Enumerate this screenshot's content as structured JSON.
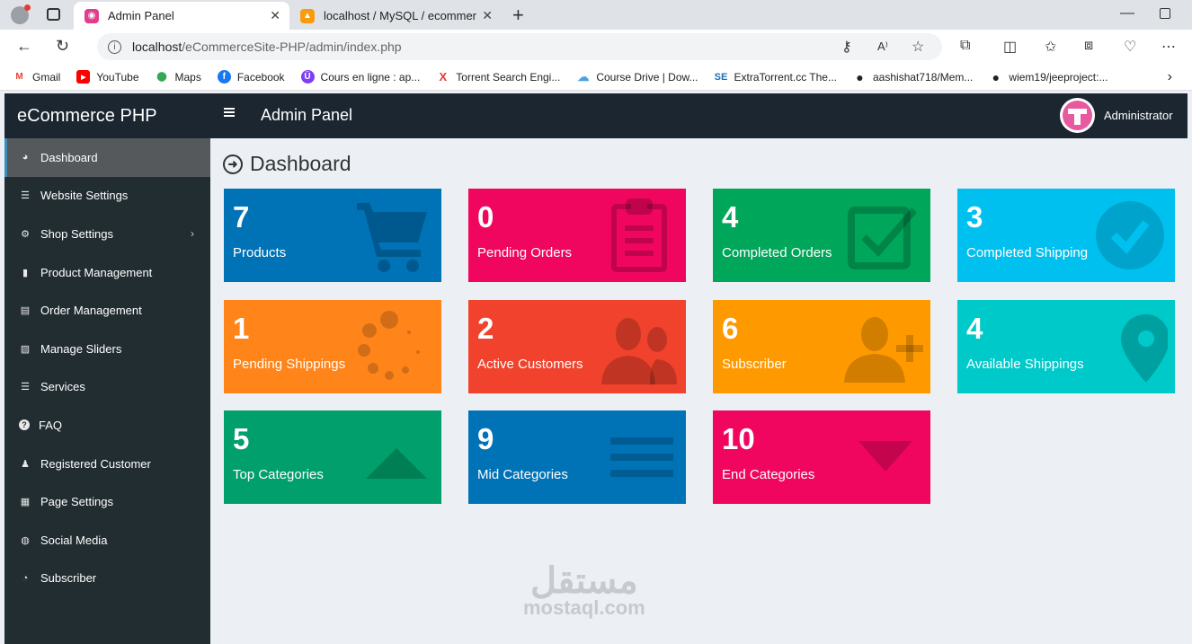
{
  "browser": {
    "tabs": [
      {
        "title": "Admin Panel",
        "active": true
      },
      {
        "title": "localhost / MySQL / ecommerce",
        "active": false
      }
    ],
    "url_host": "localhost",
    "url_path": "/eCommerceSite-PHP/admin/index.php",
    "bookmarks": [
      {
        "label": "Gmail",
        "icon": "gmail-icon",
        "color": "#ea4335",
        "glyph": "M"
      },
      {
        "label": "YouTube",
        "icon": "youtube-icon",
        "color": "#ff0000",
        "glyph": "▶"
      },
      {
        "label": "Maps",
        "icon": "maps-icon",
        "color": "#34a853",
        "glyph": "⬤"
      },
      {
        "label": "Facebook",
        "icon": "facebook-icon",
        "color": "#1877f2",
        "glyph": "f"
      },
      {
        "label": "Cours en ligne : ap...",
        "icon": "course-icon",
        "color": "#7e3ff2",
        "glyph": "Ü"
      },
      {
        "label": "Torrent Search Engi...",
        "icon": "torrent-icon",
        "color": "#e53935",
        "glyph": "X"
      },
      {
        "label": "Course Drive | Dow...",
        "icon": "cloud-icon",
        "color": "#4aa3df",
        "glyph": "☁"
      },
      {
        "label": "ExtraTorrent.cc The...",
        "icon": "se-icon",
        "color": "#1e6fb8",
        "glyph": "SE"
      },
      {
        "label": "aashishat718/Mem...",
        "icon": "github-icon",
        "color": "#222222",
        "glyph": "●"
      },
      {
        "label": "wiem19/jeeproject:...",
        "icon": "github-icon",
        "color": "#222222",
        "glyph": "●"
      }
    ]
  },
  "app": {
    "brand": "eCommerce PHP",
    "header_title": "Admin Panel",
    "user_name": "Administrator"
  },
  "sidebar": {
    "items": [
      {
        "label": "Dashboard",
        "icon": "dashboard-icon",
        "glyph": "◕",
        "active": true
      },
      {
        "label": "Website Settings",
        "icon": "sliders-icon",
        "glyph": "☰",
        "active": false
      },
      {
        "label": "Shop Settings",
        "icon": "cogs-icon",
        "glyph": "⚙",
        "active": false,
        "has_children": true
      },
      {
        "label": "Product Management",
        "icon": "shopping-bag-icon",
        "glyph": "▮",
        "active": false
      },
      {
        "label": "Order Management",
        "icon": "sticky-note-icon",
        "glyph": "▤",
        "active": false
      },
      {
        "label": "Manage Sliders",
        "icon": "picture-icon",
        "glyph": "▨",
        "active": false
      },
      {
        "label": "Services",
        "icon": "list-icon",
        "glyph": "☰",
        "active": false
      },
      {
        "label": "FAQ",
        "icon": "question-circle-icon",
        "glyph": "?",
        "active": false
      },
      {
        "label": "Registered Customer",
        "icon": "user-plus-icon",
        "glyph": "♟",
        "active": false
      },
      {
        "label": "Page Settings",
        "icon": "tasks-icon",
        "glyph": "▦",
        "active": false
      },
      {
        "label": "Social Media",
        "icon": "globe-icon",
        "glyph": "◍",
        "active": false
      },
      {
        "label": "Subscriber",
        "icon": "clock-icon",
        "glyph": "◔",
        "active": false
      }
    ]
  },
  "main": {
    "page_title": "Dashboard",
    "cards": [
      {
        "value": "7",
        "label": "Products",
        "color": "#0073b7",
        "icon": "cart-icon"
      },
      {
        "value": "0",
        "label": "Pending Orders",
        "color": "#f0065f",
        "icon": "clipboard-icon"
      },
      {
        "value": "4",
        "label": "Completed Orders",
        "color": "#00a65a",
        "icon": "check-square-icon"
      },
      {
        "value": "3",
        "label": "Completed Shipping",
        "color": "#00c0ef",
        "icon": "check-circle-icon"
      },
      {
        "value": "1",
        "label": "Pending Shippings",
        "color": "#ff851b",
        "icon": "spinner-icon"
      },
      {
        "value": "2",
        "label": "Active Customers",
        "color": "#f0422c",
        "icon": "users-icon"
      },
      {
        "value": "6",
        "label": "Subscriber",
        "color": "#ff9900",
        "icon": "user-plus-icon"
      },
      {
        "value": "4",
        "label": "Available Shippings",
        "color": "#00c9c9",
        "icon": "map-marker-icon"
      },
      {
        "value": "5",
        "label": "Top Categories",
        "color": "#009f6b",
        "icon": "caret-up-icon"
      },
      {
        "value": "9",
        "label": "Mid Categories",
        "color": "#0073b7",
        "icon": "bars-icon"
      },
      {
        "value": "10",
        "label": "End Categories",
        "color": "#f0065f",
        "icon": "caret-down-icon"
      }
    ]
  },
  "watermark": {
    "arabic": "مستقل",
    "latin": "mostaql.com"
  }
}
